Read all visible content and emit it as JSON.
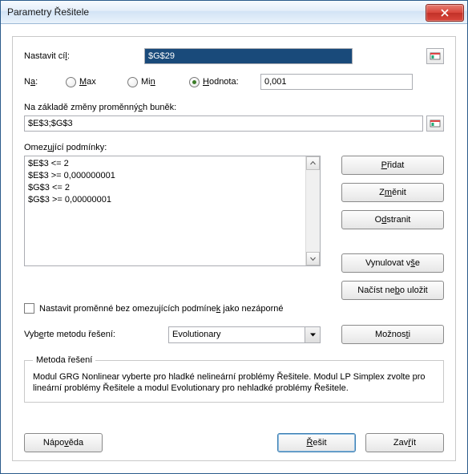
{
  "window": {
    "title": "Parametry Řešitele"
  },
  "objective": {
    "label_pre": "Nastavit cí",
    "label_u": "l",
    "label_post": ":",
    "value": "$G$29"
  },
  "to": {
    "label_pre": "N",
    "label_u": "a",
    "label_post": ":",
    "max_u": "M",
    "max_post": "ax",
    "min_pre": "Mi",
    "min_u": "n",
    "value_u": "H",
    "value_post": "odnota:",
    "value_input": "0,001",
    "selected": "value"
  },
  "changing": {
    "label_pre": "Na základě změny proměnný",
    "label_u": "c",
    "label_post": "h buněk:",
    "value": "$E$3;$G$3"
  },
  "constraints": {
    "label_pre": "Omez",
    "label_u": "u",
    "label_post": "jící podmínky:",
    "items": [
      "$E$3 <= 2",
      "$E$3 >= 0,000000001",
      "$G$3 <= 2",
      "$G$3 >= 0,00000001"
    ]
  },
  "side": {
    "add_u": "P",
    "add_post": "řidat",
    "change_pre": "Z",
    "change_u": "m",
    "change_post": "ěnit",
    "delete_pre": "O",
    "delete_u": "d",
    "delete_post": "stranit",
    "reset_pre": "Vynulovat v",
    "reset_u": "š",
    "reset_post": "e",
    "loadsave_pre": "Načíst ne",
    "loadsave_u": "b",
    "loadsave_post": "o uložit"
  },
  "unconstrained": {
    "label_pre": "Nastavit proměnné bez omezujících podmíne",
    "label_u": "k",
    "label_post": " jako nezáporné"
  },
  "method": {
    "label_pre": "Vyb",
    "label_u": "e",
    "label_post": "rte metodu řešení:",
    "selected": "Evolutionary",
    "options_pre": "Možnos",
    "options_u": "t",
    "options_post": "i"
  },
  "method_desc": {
    "legend": "Metoda řešení",
    "text": "Modul GRG Nonlinear vyberte pro hladké nelineární problémy Řešitele. Modul LP Simplex zvolte pro lineární problémy Řešitele a modul Evolutionary pro nehladké problémy Řešitele."
  },
  "bottom": {
    "help_pre": "Nápo",
    "help_u": "v",
    "help_post": "ěda",
    "solve_u": "Ř",
    "solve_post": "ešit",
    "close_pre": "Zav",
    "close_u": "ř",
    "close_post": "ít"
  }
}
